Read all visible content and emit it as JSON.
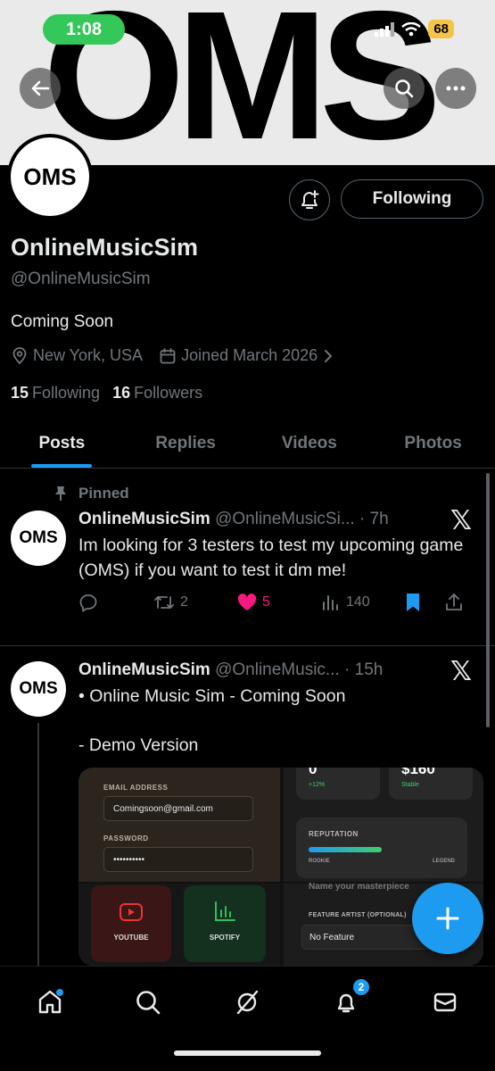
{
  "status_bar": {
    "time": "1:08",
    "battery": "68"
  },
  "banner": {
    "text": "OMS"
  },
  "profile": {
    "avatar_text": "OMS",
    "following_button": "Following",
    "display_name": "OnlineMusicSim",
    "handle": "@OnlineMusicSim",
    "bio": "Coming Soon",
    "location": "New York, USA",
    "joined": "Joined March 2026",
    "following_count": "15",
    "following_label": "Following",
    "followers_count": "16",
    "followers_label": "Followers"
  },
  "tabs": [
    {
      "label": "Posts"
    },
    {
      "label": "Replies"
    },
    {
      "label": "Videos"
    },
    {
      "label": "Photos"
    }
  ],
  "posts": [
    {
      "pinned_label": "Pinned",
      "avatar_text": "OMS",
      "name": "OnlineMusicSim",
      "handle": "@OnlineMusicSi...",
      "time": "· 7h",
      "text": "Im looking for 3 testers to test my upcoming game (OMS) if you want to test it dm me!",
      "reposts": "2",
      "likes": "5",
      "views": "140"
    },
    {
      "avatar_text": "OMS",
      "name": "OnlineMusicSim",
      "handle": "@OnlineMusic...",
      "time": "· 15h",
      "text_line1": "• Online Music Sim - Coming Soon",
      "text_line2": "- Demo Version",
      "media": {
        "top_val1": "0",
        "top_val2": "$160",
        "top_sub1": "+12%",
        "top_sub2": "Stable",
        "email_label": "EMAIL ADDRESS",
        "email_value": "Comingsoon@gmail.com",
        "password_label": "PASSWORD",
        "password_value": "••••••••••",
        "reputation_label": "REPUTATION",
        "rookie": "ROOKIE",
        "legend": "LEGEND",
        "masterpiece": "Name your masterpiece",
        "feature_label": "FEATURE ARTIST (OPTIONAL)",
        "feature_value": "No Feature",
        "youtube": "YOUTUBE",
        "spotify": "SPOTIFY"
      }
    }
  ],
  "notifications_badge": "2",
  "colors": {
    "accent": "#1d9bf0",
    "like": "#f91880"
  }
}
